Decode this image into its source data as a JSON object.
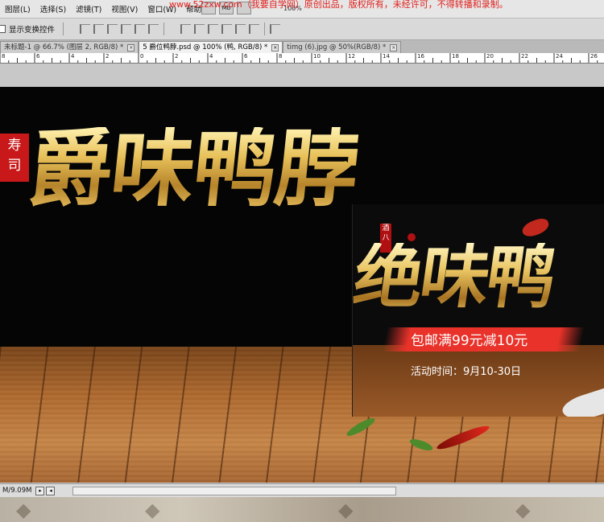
{
  "app": {
    "menus": [
      "图层(L)",
      "选择(S)",
      "滤镜(T)",
      "视图(V)",
      "窗口(W)",
      "帮助(H)"
    ],
    "watermark": "www.52zxw.com（我要自学网）原创出品，版权所有，未经许可，不得转播和录制。",
    "menu_icon_label": "Mb",
    "zoom_percent": "100%"
  },
  "options_bar": {
    "show_transform_controls": "显示变换控件"
  },
  "tabs": [
    {
      "label": "未标题-1 @ 66.7% (图层 2, RGB/8) *",
      "close": "×",
      "active": false
    },
    {
      "label": "5 爵位鸭脖.psd @ 100% (鸭, RGB/8) *",
      "close": "×",
      "active": true
    },
    {
      "label": "timg (6).jpg @ 50%(RGB/8) *",
      "close": "×",
      "active": false
    }
  ],
  "ruler": {
    "numbers": [
      "8",
      "6",
      "4",
      "2",
      "0",
      "2",
      "4",
      "6",
      "8",
      "10",
      "12",
      "14",
      "16",
      "18",
      "20",
      "22",
      "24",
      "26",
      "28"
    ]
  },
  "artwork": {
    "seal_text": [
      "寿",
      "司"
    ],
    "main_title": "爵味鸭脖",
    "overlay": {
      "seal_text": "酒八",
      "title": "绝味鸭",
      "promo": "包邮满99元减10元",
      "date": "活动时间：9月10-30日"
    }
  },
  "status": {
    "doc_size": "M/9.09M",
    "nav_prev": "◂",
    "nav_next": "▸"
  },
  "colors": {
    "watermark": "#e0201d",
    "seal_red": "#c8181a",
    "gold": "#e8c15a",
    "promo_red": "#e8322a"
  }
}
